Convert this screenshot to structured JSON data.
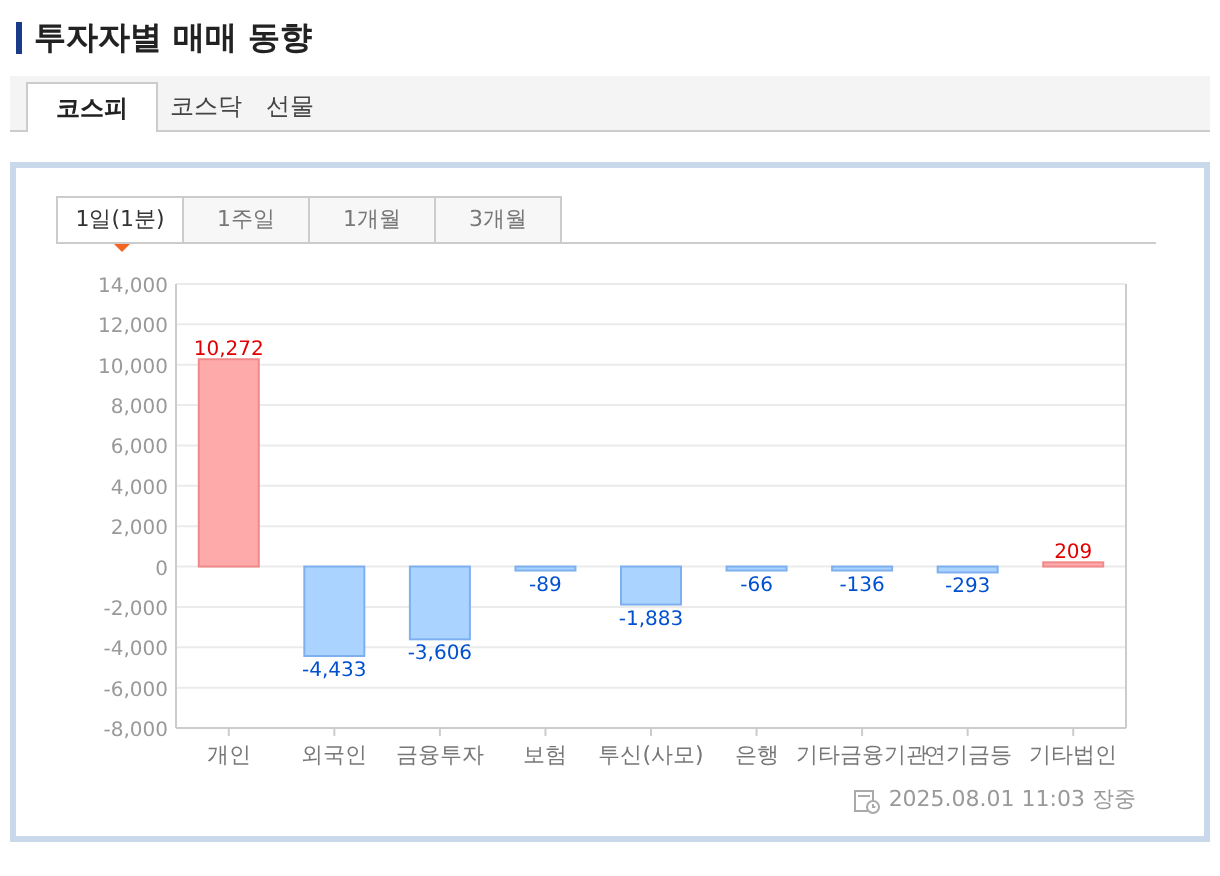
{
  "title": "투자자별 매매 동향",
  "market_tabs": [
    {
      "label": "코스피",
      "selected": true
    },
    {
      "label": "코스닥",
      "selected": false
    },
    {
      "label": "선물",
      "selected": false
    }
  ],
  "period_tabs": [
    {
      "label": "1일(1분)",
      "selected": true
    },
    {
      "label": "1주일",
      "selected": false
    },
    {
      "label": "1개월",
      "selected": false
    },
    {
      "label": "3개월",
      "selected": false
    }
  ],
  "chart_data": {
    "type": "bar",
    "categories": [
      "개인",
      "외국인",
      "금융투자",
      "보험",
      "투신(사모)",
      "은행",
      "기타금융기관",
      "연기금등",
      "기타법인"
    ],
    "grid": true,
    "series": [
      {
        "values": [
          10272,
          -4433,
          -3606,
          -89,
          -1883,
          -66,
          -136,
          -293,
          209
        ]
      }
    ],
    "value_labels": [
      "10,272",
      "-4,433",
      "-3,606",
      "-89",
      "-1,883",
      "-66",
      "-136",
      "-293",
      "209"
    ],
    "ylim": [
      -8000,
      14000
    ],
    "yticks": [
      {
        "value": -8000,
        "label": "-8,000"
      },
      {
        "value": -6000,
        "label": "-6,000"
      },
      {
        "value": -4000,
        "label": "-4,000"
      },
      {
        "value": -2000,
        "label": "-2,000"
      },
      {
        "value": 0,
        "label": "0"
      },
      {
        "value": 2000,
        "label": "2,000"
      },
      {
        "value": 4000,
        "label": "4,000"
      },
      {
        "value": 6000,
        "label": "6,000"
      },
      {
        "value": 8000,
        "label": "8,000"
      },
      {
        "value": 10000,
        "label": "10,000"
      },
      {
        "value": 12000,
        "label": "12,000"
      },
      {
        "value": 14000,
        "label": "14,000"
      }
    ]
  },
  "timestamp": "2025.08.01 11:03 장중"
}
